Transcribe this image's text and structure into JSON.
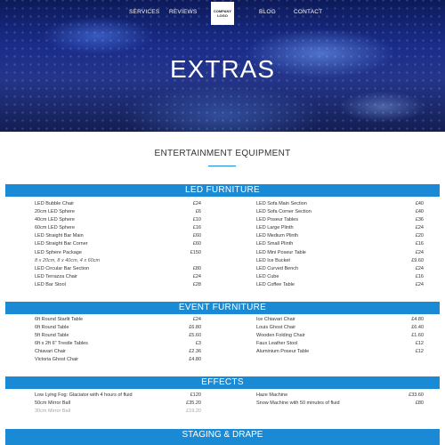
{
  "nav": {
    "services": "SERVICES",
    "reviews": "REVIEWS",
    "logo": "COMPANY LOGO",
    "blog": "BLOG",
    "contact": "CONTACT"
  },
  "hero": {
    "title": "EXTRAS"
  },
  "section": {
    "heading": "ENTERTAINMENT EQUIPMENT"
  },
  "accent_color": "#1a8ad4",
  "led_furniture": {
    "title": "LED FURNITURE",
    "left": [
      {
        "name": "LED Bubble Chair",
        "price": "£24"
      },
      {
        "name": "20cm LED Sphere",
        "price": "£6"
      },
      {
        "name": "40cm LED Sphere",
        "price": "£10"
      },
      {
        "name": "60cm LED Sphere",
        "price": "£16"
      },
      {
        "name": "LED Straight Bar Main",
        "price": "£60"
      },
      {
        "name": "LED Straight Bar Corner",
        "price": "£60"
      },
      {
        "name": "LED Sphere Package",
        "price": "£150"
      },
      {
        "name": "8 x 20cm, 8 x 40cm, 4 x 60cm",
        "price": "",
        "note": true
      },
      {
        "name": "LED Circular Bar Section",
        "price": "£80"
      },
      {
        "name": "LED Terrazza Chair",
        "price": "£24"
      },
      {
        "name": "LED Bar Stool",
        "price": "£28"
      }
    ],
    "right": [
      {
        "name": "LED Sofa Main Section",
        "price": "£40"
      },
      {
        "name": "LED Sofa Corner Section",
        "price": "£40"
      },
      {
        "name": "LED Poseur Tables",
        "price": "£36"
      },
      {
        "name": "LED Large Plinth",
        "price": "£24"
      },
      {
        "name": "LED Medium Plinth",
        "price": "£20"
      },
      {
        "name": "LED Small Plinth",
        "price": "£16"
      },
      {
        "name": "LED Mini Poseur Table",
        "price": "£24"
      },
      {
        "name": "LED Ice Bucket",
        "price": "£9.60"
      },
      {
        "name": "LED Curved Bench",
        "price": "£24"
      },
      {
        "name": "LED Cube",
        "price": "£16"
      },
      {
        "name": "LED Coffee Table",
        "price": "£24"
      }
    ]
  },
  "event_furniture": {
    "title": "EVENT FURNITURE",
    "left": [
      {
        "name": "6ft Round Starlit Table",
        "price": "£24"
      },
      {
        "name": "6ft Round Table",
        "price": "£6.80"
      },
      {
        "name": "5ft Round Table",
        "price": "£5.60"
      },
      {
        "name": "6ft x 2ft 6\" Trestle Tables",
        "price": "£3"
      },
      {
        "name": "Chiavari Chair",
        "price": "£2.36"
      },
      {
        "name": "Victoria Ghost Chair",
        "price": "£4.80"
      }
    ],
    "right": [
      {
        "name": "Ice Chiavari Chair",
        "price": "£4.80"
      },
      {
        "name": "Louis Ghost Chair",
        "price": "£6.40"
      },
      {
        "name": "Wooden Folding Chair",
        "price": "£1.60"
      },
      {
        "name": "Faux Leather Stool",
        "price": "£12"
      },
      {
        "name": "Aluminium Poseur Table",
        "price": "£12"
      }
    ]
  },
  "effects": {
    "title": "EFFECTS",
    "left": [
      {
        "name": "Low Lying Fog: Glaciator with 4 hours of fluid",
        "price": "£120"
      },
      {
        "name": "50cm Mirror Ball",
        "price": "£35.20"
      },
      {
        "name": "30cm Mirror Ball",
        "price": "£19.20",
        "fade": true
      }
    ],
    "right": [
      {
        "name": "Haze Machine",
        "price": "£33.60"
      },
      {
        "name": "Snow Machine with 50 minutes of fluid",
        "price": "£80"
      }
    ]
  },
  "next_section": {
    "title": "STAGING & DRAPE"
  }
}
